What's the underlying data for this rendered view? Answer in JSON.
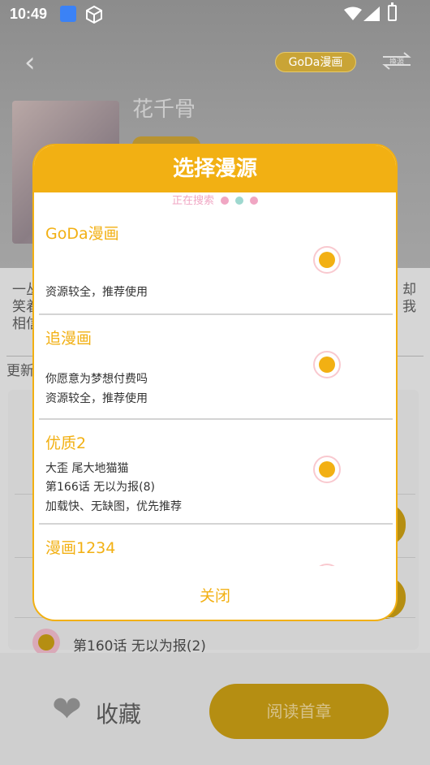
{
  "status_bar": {
    "time": "10:49"
  },
  "background": {
    "source_badge": "GoDa漫画",
    "swap_label": "换源",
    "comic_title": "花千骨",
    "description_left": "一丛\n笑着\n相信",
    "description_right": "却\n我",
    "update_label": "更新",
    "chapter_item": "第160话 无以为报(2)",
    "favorite_label": "收藏",
    "read_button": "阅读首章"
  },
  "dialog": {
    "title": "选择漫源",
    "searching": "正在搜索",
    "dot_colors": [
      "#f0a6c3",
      "#9ed8cf",
      "#f0a6c3"
    ],
    "sources": [
      {
        "name": "GoDa漫画",
        "lines": [
          "",
          "资源较全，推荐使用"
        ]
      },
      {
        "name": "追漫画",
        "lines": [
          "你愿意为梦想付费吗",
          "资源较全，推荐使用"
        ]
      },
      {
        "name": "优质2",
        "lines": [
          "大歪 尾大地猫猫",
          "第166话 无以为报(8)",
          "加载快、无缺图，优先推荐"
        ]
      },
      {
        "name": "漫画1234",
        "lines": []
      }
    ],
    "close": "关闭"
  },
  "colors": {
    "accent": "#f2b013",
    "radio_ring": "#f9c9cf"
  }
}
